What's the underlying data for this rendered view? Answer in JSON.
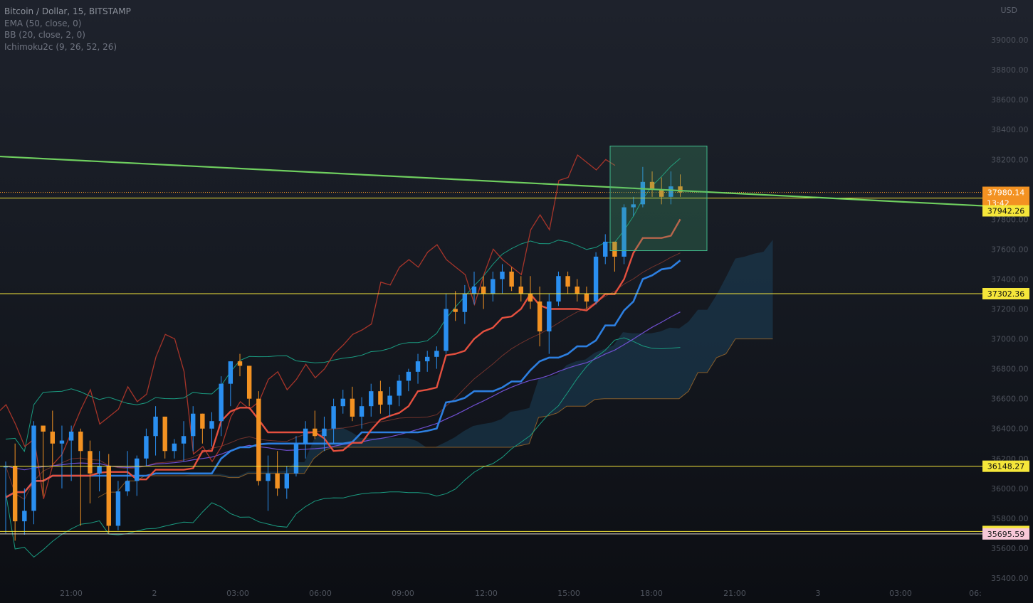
{
  "legend": {
    "title": "Bitcoin / Dollar, 15, BITSTAMP",
    "indicators": [
      "EMA (50, close, 0)",
      "BB (20, close, 2, 0)",
      "Ichimoku2c (9, 26, 52, 26)"
    ]
  },
  "currency": "USD",
  "colors": {
    "bull": "#2a8ff0",
    "bear": "#f39222",
    "tenkan": "#e5503f",
    "kijun": "#2d7fe0",
    "chikou": "#c0392b",
    "ema": "#6f4fd0",
    "bb": "#1a9b80",
    "trendline": "#6fcf5f",
    "level": "#f5e63a",
    "cloud": "#1d4a66",
    "span_b": "#b8762a"
  },
  "chart_data": {
    "type": "candlestick",
    "symbol": "Bitcoin / Dollar",
    "interval": "15",
    "exchange": "BITSTAMP",
    "ylim": [
      35400,
      39200
    ],
    "y_ticks": [
      35400,
      35600,
      35800,
      36000,
      36200,
      36400,
      36600,
      36800,
      37000,
      37200,
      37400,
      37600,
      37800,
      38000,
      38200,
      38400,
      38600,
      38800,
      39000
    ],
    "x_ticks": [
      "21:00",
      "2",
      "03:00",
      "06:00",
      "09:00",
      "12:00",
      "15:00",
      "18:00",
      "21:00",
      "3",
      "03:00",
      "06:"
    ],
    "current_price": "37980.14",
    "countdown": "13:42",
    "levels": [
      "37942.26",
      "37302.36",
      "36148.27",
      "35711.90"
    ],
    "low_marker": "35695.59",
    "candles": [
      [
        36150,
        36180,
        35700,
        36150
      ],
      [
        36150,
        36300,
        35650,
        35780
      ],
      [
        35780,
        36000,
        35690,
        35850
      ],
      [
        35850,
        36450,
        35760,
        36420
      ],
      [
        36420,
        36200,
        35950,
        36380
      ],
      [
        36380,
        36520,
        36150,
        36300
      ],
      [
        36300,
        36420,
        36000,
        36320
      ],
      [
        36320,
        36420,
        36050,
        36380
      ],
      [
        36380,
        36400,
        35750,
        36250
      ],
      [
        36250,
        36320,
        35900,
        36100
      ],
      [
        36100,
        36250,
        35980,
        36150
      ],
      [
        36150,
        36230,
        35700,
        35750
      ],
      [
        35750,
        36050,
        35720,
        35980
      ],
      [
        35980,
        36250,
        35950,
        36050
      ],
      [
        36050,
        36220,
        35950,
        36200
      ],
      [
        36200,
        36400,
        36150,
        36350
      ],
      [
        36350,
        36550,
        36220,
        36480
      ],
      [
        36480,
        36450,
        36200,
        36250
      ],
      [
        36250,
        36330,
        36200,
        36300
      ],
      [
        36300,
        36450,
        36180,
        36350
      ],
      [
        36350,
        36550,
        36250,
        36500
      ],
      [
        36500,
        36480,
        36300,
        36400
      ],
      [
        36400,
        36510,
        36280,
        36450
      ],
      [
        36450,
        36750,
        36350,
        36700
      ],
      [
        36700,
        36850,
        36550,
        36850
      ],
      [
        36850,
        36900,
        36750,
        36820
      ],
      [
        36820,
        36800,
        36550,
        36600
      ],
      [
        36600,
        36650,
        36020,
        36050
      ],
      [
        36050,
        36220,
        35850,
        36100
      ],
      [
        36100,
        36250,
        35950,
        36000
      ],
      [
        36000,
        36150,
        35930,
        36100
      ],
      [
        36100,
        36350,
        36080,
        36300
      ],
      [
        36300,
        36450,
        36200,
        36400
      ],
      [
        36400,
        36520,
        36330,
        36350
      ],
      [
        36350,
        36480,
        36250,
        36400
      ],
      [
        36400,
        36600,
        36300,
        36550
      ],
      [
        36550,
        36660,
        36500,
        36600
      ],
      [
        36600,
        36680,
        36450,
        36480
      ],
      [
        36480,
        36610,
        36400,
        36550
      ],
      [
        36550,
        36700,
        36480,
        36650
      ],
      [
        36650,
        36720,
        36500,
        36560
      ],
      [
        36560,
        36680,
        36480,
        36620
      ],
      [
        36620,
        36760,
        36550,
        36720
      ],
      [
        36720,
        36800,
        36650,
        36780
      ],
      [
        36780,
        36900,
        36700,
        36850
      ],
      [
        36850,
        36920,
        36780,
        36880
      ],
      [
        36880,
        36950,
        36800,
        36920
      ],
      [
        36920,
        37300,
        36900,
        37200
      ],
      [
        37200,
        37320,
        37120,
        37180
      ],
      [
        37180,
        37360,
        37100,
        37300
      ],
      [
        37300,
        37450,
        37230,
        37350
      ],
      [
        37350,
        37420,
        37200,
        37300
      ],
      [
        37300,
        37450,
        37250,
        37400
      ],
      [
        37400,
        37500,
        37300,
        37450
      ],
      [
        37450,
        37480,
        37320,
        37350
      ],
      [
        37350,
        37420,
        37250,
        37300
      ],
      [
        37300,
        37420,
        37200,
        37250
      ],
      [
        37250,
        37350,
        36950,
        37050
      ],
      [
        37050,
        37300,
        36900,
        37250
      ],
      [
        37250,
        37450,
        37220,
        37420
      ],
      [
        37420,
        37450,
        37300,
        37350
      ],
      [
        37350,
        37400,
        37250,
        37300
      ],
      [
        37300,
        37350,
        37200,
        37250
      ],
      [
        37250,
        37580,
        37230,
        37550
      ],
      [
        37550,
        37700,
        37500,
        37650
      ],
      [
        37650,
        37650,
        37450,
        37550
      ],
      [
        37550,
        37900,
        37500,
        37880
      ],
      [
        37880,
        37950,
        37820,
        37900
      ],
      [
        37900,
        38150,
        37880,
        38050
      ],
      [
        38050,
        38120,
        37950,
        38000
      ],
      [
        38000,
        38080,
        37900,
        37950
      ],
      [
        37950,
        38120,
        37900,
        38020
      ],
      [
        38020,
        38100,
        37950,
        37980
      ]
    ]
  }
}
